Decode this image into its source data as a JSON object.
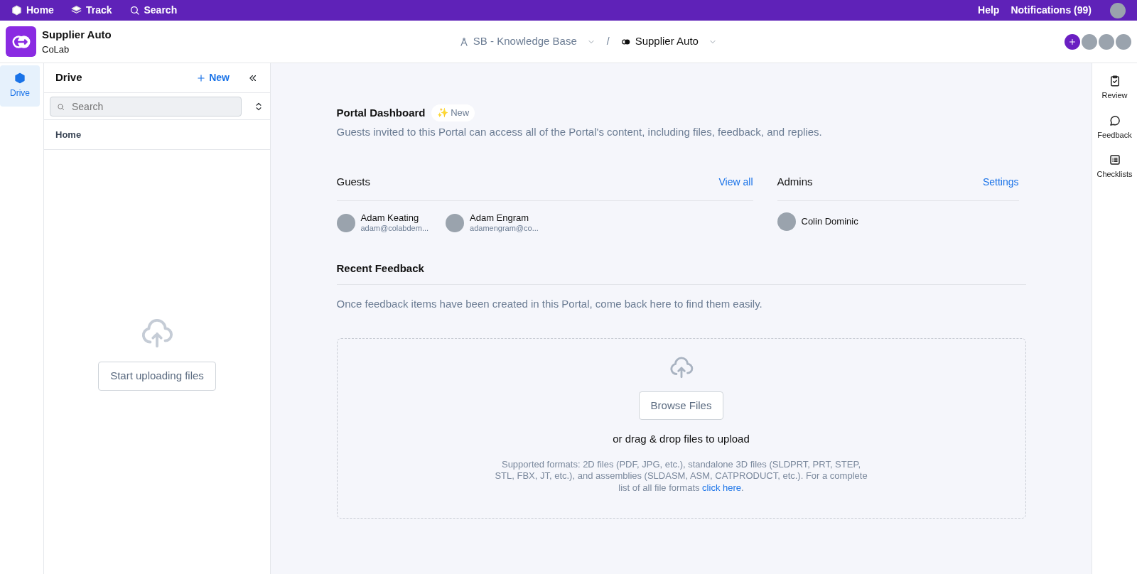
{
  "top_nav": {
    "left": [
      {
        "label": "Home"
      },
      {
        "label": "Track"
      },
      {
        "label": "Search"
      }
    ],
    "right": [
      {
        "label": "Help"
      },
      {
        "label": "Notifications (99)"
      }
    ]
  },
  "header": {
    "workspace": "Supplier Auto",
    "org": "CoLab",
    "breadcrumbs": [
      {
        "label": "SB - Knowledge Base",
        "muted": true
      },
      {
        "label": "Supplier Auto",
        "muted": false
      }
    ],
    "separator": "/"
  },
  "left_rail": [
    {
      "label": "Drive",
      "selected": true
    }
  ],
  "drive": {
    "title": "Drive",
    "new_label": "New",
    "search_placeholder": "Search",
    "tree": [
      {
        "label": "Home"
      }
    ],
    "upload_button": "Start uploading files"
  },
  "dashboard": {
    "title": "Portal Dashboard",
    "badge": "✨ New",
    "description": "Guests invited to this Portal can access all of the Portal's content, including files, feedback, and replies.",
    "guests": {
      "title": "Guests",
      "link": "View all",
      "people": [
        {
          "name": "Adam Keating",
          "email": "adam@colabdem..."
        },
        {
          "name": "Adam Engram",
          "email": "adamengram@co..."
        }
      ]
    },
    "admins": {
      "title": "Admins",
      "link": "Settings",
      "people": [
        {
          "name": "Colin Dominic"
        }
      ]
    },
    "feedback": {
      "title": "Recent Feedback",
      "empty": "Once feedback items have been created in this Portal, come back here to find them easily."
    },
    "upload": {
      "button": "Browse Files",
      "hint": "or drag & drop files to upload",
      "note_before": "Supported formats: 2D files (PDF, JPG, etc.), standalone 3D files (SLDPRT, PRT, STEP, STL, FBX, JT, etc.), and assemblies (SLDASM, ASM, CATPRODUCT, etc.). For a complete list of all file formats ",
      "note_link": "click here",
      "note_after": "."
    }
  },
  "right_rail": [
    {
      "label": "Review"
    },
    {
      "label": "Feedback"
    },
    {
      "label": "Checklists"
    }
  ]
}
